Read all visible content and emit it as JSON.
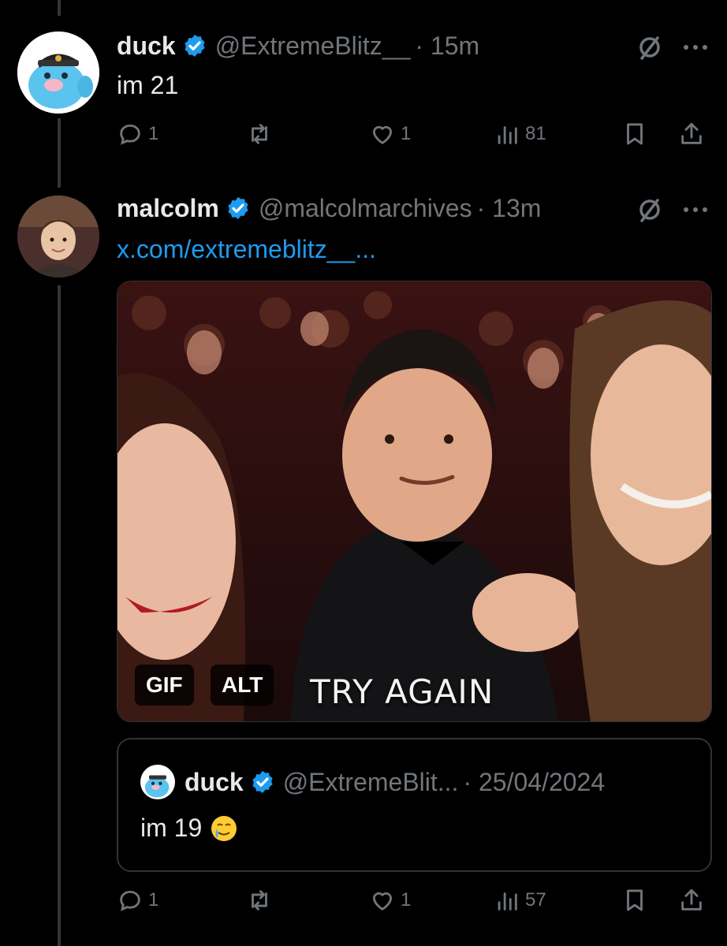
{
  "tweets": [
    {
      "name": "duck",
      "handle": "@ExtremeBlitz__",
      "time": "· 15m",
      "text": "im 21",
      "avatar_icon": "duck-avatar",
      "replies": "1",
      "reposts": "",
      "likes": "1",
      "views": "81"
    },
    {
      "name": "malcolm",
      "handle": "@malcolmarchives",
      "time": "· 13m",
      "link": "x.com/extremeblitz__...",
      "avatar_icon": "malcolm-avatar",
      "media": {
        "gif_badge": "GIF",
        "alt_badge": "ALT",
        "caption": "TRY AGAIN"
      },
      "quote": {
        "name": "duck",
        "handle": "@ExtremeBlit...",
        "date": "· 25/04/2024",
        "text": "im 19",
        "emoji_icon": "tearful-smile-emoji"
      },
      "replies": "1",
      "reposts": "",
      "likes": "1",
      "views": "57"
    }
  ],
  "colors": {
    "background": "#000000",
    "text": "#e7e9ea",
    "secondary": "#71767b",
    "link": "#1d9bf0",
    "verified": "#1d9bf0"
  }
}
